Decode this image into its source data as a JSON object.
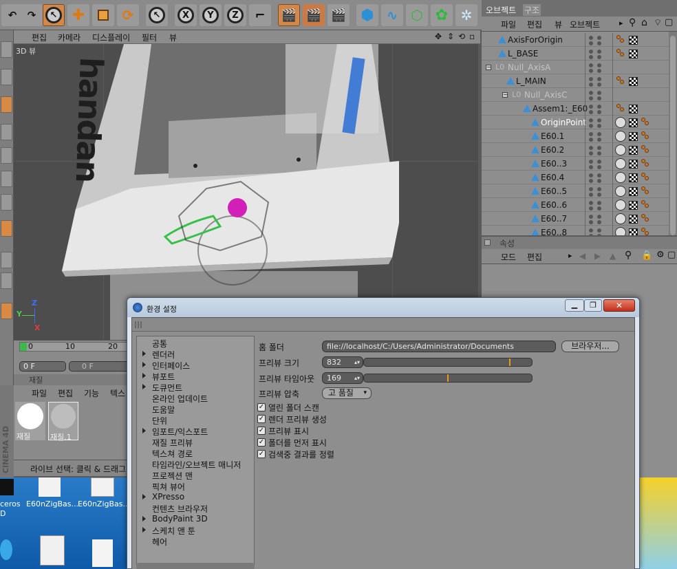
{
  "viewport": {
    "menu": [
      "편집",
      "카메라",
      "디스플레이",
      "필터",
      "뷰"
    ],
    "label": "3D 뷰",
    "axis": {
      "z": "Z",
      "y": "Y",
      "x": "X"
    },
    "model_text": "handan"
  },
  "timeline": {
    "ticks": [
      "0",
      "10",
      "20"
    ],
    "frame_start": "0 F",
    "frame_current": "0 F"
  },
  "material_panel": {
    "title": "재질",
    "menu": [
      "파일",
      "편집",
      "기능",
      "텍스"
    ],
    "materials": [
      {
        "name": "재질"
      },
      {
        "name": "재질.1"
      }
    ]
  },
  "status_text": "라이브 선택: 클릭 & 드래그",
  "brand": "CINEMA 4D",
  "object_manager": {
    "tabs": [
      "오브젝트",
      "구조"
    ],
    "menu": [
      "파일",
      "편집",
      "뷰",
      "오브젝트"
    ],
    "objects": [
      {
        "name": "AxisForOrigin",
        "indent": 0,
        "type": "tri"
      },
      {
        "name": "L_BASE",
        "indent": 0,
        "type": "tri"
      },
      {
        "name": "Null_AxisA",
        "indent": 0,
        "type": "null"
      },
      {
        "name": "L_MAIN",
        "indent": 1,
        "type": "tri"
      },
      {
        "name": "Null_AxisC",
        "indent": 2,
        "type": "null"
      },
      {
        "name": "Assem1:_E60",
        "indent": 3,
        "type": "tri"
      },
      {
        "name": "OriginPoint",
        "indent": 4,
        "type": "tri",
        "highlight": true
      },
      {
        "name": "E60.1",
        "indent": 4,
        "type": "tri"
      },
      {
        "name": "E60.2",
        "indent": 4,
        "type": "tri"
      },
      {
        "name": "E60..3",
        "indent": 4,
        "type": "tri"
      },
      {
        "name": "E60.4",
        "indent": 4,
        "type": "tri"
      },
      {
        "name": "E60..5",
        "indent": 4,
        "type": "tri"
      },
      {
        "name": "E60..6",
        "indent": 4,
        "type": "tri"
      },
      {
        "name": "E60..7",
        "indent": 4,
        "type": "tri"
      },
      {
        "name": "E60..8",
        "indent": 4,
        "type": "tri"
      }
    ]
  },
  "attributes": {
    "title": "속성",
    "menu": [
      "모드",
      "편집"
    ]
  },
  "desktop": {
    "icons": [
      "ceros",
      "E60nZigBas...",
      "E60nZigBas..."
    ],
    "side_label": "D"
  },
  "dialog": {
    "title": "환경 설정",
    "tree": [
      {
        "label": "공통",
        "arrow": false
      },
      {
        "label": "렌더러",
        "arrow": true
      },
      {
        "label": "인터페이스",
        "arrow": true
      },
      {
        "label": "뷰포트",
        "arrow": true
      },
      {
        "label": "도큐먼트",
        "arrow": true
      },
      {
        "label": "온라인 업데이트",
        "arrow": false
      },
      {
        "label": "도움말",
        "arrow": false
      },
      {
        "label": "단위",
        "arrow": false
      },
      {
        "label": "임포트/익스포트",
        "arrow": true
      },
      {
        "label": "재질 프리뷰",
        "arrow": false
      },
      {
        "label": "텍스쳐 경로",
        "arrow": false
      },
      {
        "label": "타임라인/오브젝트 매니저",
        "arrow": false
      },
      {
        "label": "프로젝션 맨",
        "arrow": false
      },
      {
        "label": "픽쳐 뷰어",
        "arrow": false
      },
      {
        "label": "XPresso",
        "arrow": true
      },
      {
        "label": "컨텐츠 브라우저",
        "arrow": false
      },
      {
        "label": "BodyPaint 3D",
        "arrow": true
      },
      {
        "label": "스케치 앤 툰",
        "arrow": true
      },
      {
        "label": "헤어",
        "arrow": false
      }
    ],
    "home_folder_label": "홈 폴더",
    "home_folder_value": "file://localhost/C:/Users/Administrator/Documents",
    "browse_button": "브라우저...",
    "preview_size_label": "프리뷰 크기",
    "preview_size_value": "832",
    "preview_size_fraction": 0.87,
    "preview_timeout_label": "프리뷰 타임아웃",
    "preview_timeout_value": "169",
    "preview_timeout_fraction": 0.5,
    "preview_compression_label": "프리뷰 압축",
    "preview_compression_value": "고 품질",
    "checkboxes": [
      {
        "label": "열린 폴더 스캔",
        "checked": true
      },
      {
        "label": "렌더 프리뷰 생성",
        "checked": true
      },
      {
        "label": "프리뷰 표시",
        "checked": true
      },
      {
        "label": "폴더를 먼저 표시",
        "checked": true
      },
      {
        "label": "검색중 결과를 정렬",
        "checked": true
      }
    ]
  },
  "colors": {
    "accent_orange": "#d2874b",
    "object_blue": "#3d8fd6",
    "slider_knob": "#e89a1c"
  }
}
